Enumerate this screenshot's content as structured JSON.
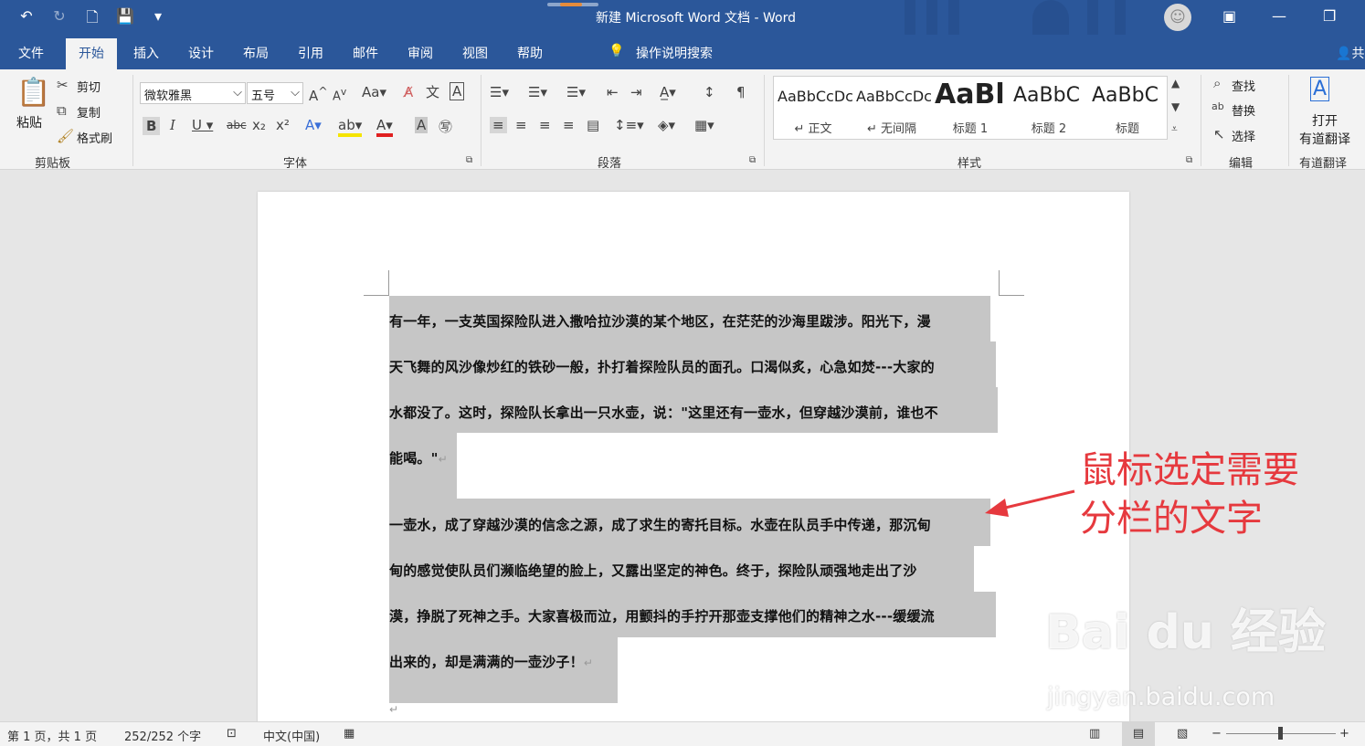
{
  "titlebar": {
    "title": "新建 Microsoft Word 文档  -  Word",
    "undo_icon": "↶",
    "redo_icon": "↻",
    "print_preview_icon": "🗋",
    "save_icon": "💾",
    "customize_icon": "▾"
  },
  "tabs": [
    {
      "label": "文件"
    },
    {
      "label": "开始"
    },
    {
      "label": "插入"
    },
    {
      "label": "设计"
    },
    {
      "label": "布局"
    },
    {
      "label": "引用"
    },
    {
      "label": "邮件"
    },
    {
      "label": "审阅"
    },
    {
      "label": "视图"
    },
    {
      "label": "帮助"
    }
  ],
  "tell_me": "操作说明搜索",
  "share_label": "共",
  "ribbon": {
    "clipboard": {
      "paste": "粘贴",
      "cut": "剪切",
      "copy": "复制",
      "format_painter": "格式刷",
      "label": "剪贴板"
    },
    "font": {
      "font_name": "微软雅黑",
      "font_size": "五号",
      "label": "字体"
    },
    "paragraph": {
      "label": "段落"
    },
    "styles": {
      "items": [
        {
          "sample": "AaBbCcDc",
          "name": "↵ 正文"
        },
        {
          "sample": "AaBbCcDc",
          "name": "↵ 无间隔"
        },
        {
          "sample": "AaBl",
          "name": "标题 1"
        },
        {
          "sample": "AaBbC",
          "name": "标题 2"
        },
        {
          "sample": "AaBbC",
          "name": "标题"
        }
      ],
      "label": "样式"
    },
    "editing": {
      "find": "查找",
      "replace": "替换",
      "select": "选择",
      "label": "编辑"
    },
    "youdao": {
      "open": "打开",
      "translate": "有道翻译",
      "label": "有道翻译"
    }
  },
  "document": {
    "lines": [
      "有一年，一支英国探险队进入撒哈拉沙漠的某个地区，在茫茫的沙海里跋涉。阳光下，漫",
      "天飞舞的风沙像炒红的铁砂一般，扑打着探险队员的面孔。口渴似炙，心急如焚---大家的",
      "水都没了。这时，探险队长拿出一只水壶，说：\"这里还有一壶水，但穿越沙漠前，谁也不",
      "能喝。\"",
      "一壶水，成了穿越沙漠的信念之源，成了求生的寄托目标。水壶在队员手中传递，那沉甸",
      "甸的感觉使队员们濒临绝望的脸上，又露出坚定的神色。终于，探险队顽强地走出了沙",
      "漠，挣脱了死神之手。大家喜极而泣，用颤抖的手拧开那壶支撑他们的精神之水---缓缓流",
      "出来的，却是满满的一壶沙子！"
    ],
    "paragraph_mark": "↵"
  },
  "annotation": {
    "line1": "鼠标选定需要",
    "line2": "分栏的文字",
    "color": "#e6393e"
  },
  "watermark": {
    "logo": "Bai du 经验",
    "url": "jingyan.baidu.com"
  },
  "status": {
    "page": "第 1 页，共 1 页",
    "words": "252/252 个字",
    "language": "中文(中国)"
  }
}
